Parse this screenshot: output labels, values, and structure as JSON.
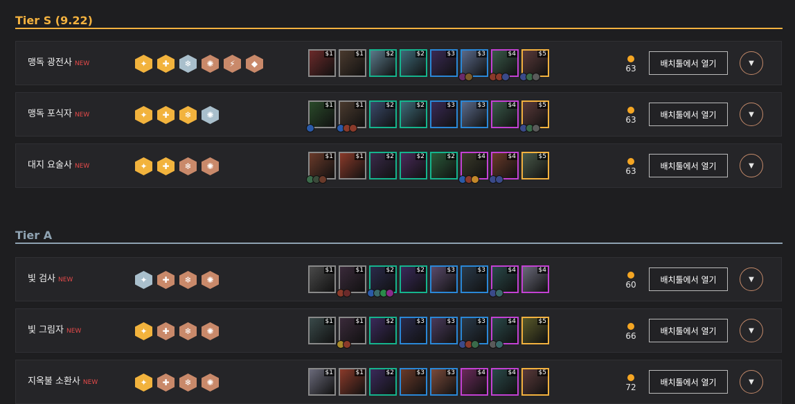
{
  "tiers": [
    {
      "title": "Tier S (9.22)"
    },
    {
      "title": "Tier A"
    }
  ],
  "open_label": "배치툴에서 열기",
  "new_label": "NEW",
  "icons": {
    "gold": "gold-coin-icon",
    "expand": "chevron-down-icon"
  },
  "colors": {
    "tierS": "#f4b23f",
    "tierA": "#8fa3b2",
    "cost1": "#8a8a8a",
    "cost2": "#15b58e",
    "cost3": "#2a88d8",
    "cost4": "#c441d4",
    "cost5": "#f4b23f"
  },
  "comps": [
    {
      "name": "맹독 광전사",
      "gold": "63",
      "traits": [
        "gold",
        "gold",
        "silver",
        "bronze",
        "bronze",
        "bronze"
      ],
      "champs": [
        {
          "cost": "$1",
          "color": "#6b2a2a",
          "items": []
        },
        {
          "cost": "$1",
          "color": "#4a3a2e",
          "items": []
        },
        {
          "cost": "$2",
          "color": "#5a7a8a",
          "items": []
        },
        {
          "cost": "$2",
          "color": "#3e6a78",
          "items": []
        },
        {
          "cost": "$3",
          "color": "#3a2a55",
          "items": []
        },
        {
          "cost": "$3",
          "color": "#5a6a8a",
          "items": [
            "#6a2a6a",
            "#7a5a2a"
          ]
        },
        {
          "cost": "$4",
          "color": "#3a5a4a",
          "items": [
            "#8a3a2a",
            "#8a3a2a",
            "#3a4a8a"
          ]
        },
        {
          "cost": "$5",
          "color": "#5a3a3a",
          "items": [
            "#3a4a8a",
            "#3a6a4a",
            "#5a5a5a"
          ]
        }
      ]
    },
    {
      "name": "맹독 포식자",
      "gold": "63",
      "traits": [
        "gold",
        "gold",
        "gold",
        "silver"
      ],
      "champs": [
        {
          "cost": "$1",
          "color": "#2a4a2a",
          "items": [
            "#2a5aa8"
          ]
        },
        {
          "cost": "$1",
          "color": "#4a3a2e",
          "items": [
            "#2a5aa8",
            "#8a3a2a",
            "#8a3a2a"
          ]
        },
        {
          "cost": "$2",
          "color": "#3a4a6a",
          "items": []
        },
        {
          "cost": "$2",
          "color": "#3e6a78",
          "items": []
        },
        {
          "cost": "$3",
          "color": "#3a2a55",
          "items": []
        },
        {
          "cost": "$3",
          "color": "#5a6a8a",
          "items": []
        },
        {
          "cost": "$4",
          "color": "#3a5a4a",
          "items": []
        },
        {
          "cost": "$5",
          "color": "#5a3a3a",
          "items": [
            "#3a4a8a",
            "#3a6a4a",
            "#5a5a5a"
          ]
        }
      ]
    },
    {
      "name": "대지 요술사",
      "gold": "63",
      "traits": [
        "gold",
        "gold",
        "bronze",
        "bronze"
      ],
      "champs": [
        {
          "cost": "$1",
          "color": "#6a3a2a",
          "items": [
            "#3a6a4a",
            "#3a4a3a",
            "#6a3a2a"
          ]
        },
        {
          "cost": "$1",
          "color": "#8a3a2a",
          "items": []
        },
        {
          "cost": "$2",
          "color": "#3a2a4a",
          "items": []
        },
        {
          "cost": "$2",
          "color": "#4a2a5a",
          "items": []
        },
        {
          "cost": "$2",
          "color": "#2a5a3a",
          "items": []
        },
        {
          "cost": "$4",
          "color": "#3a3a2a",
          "items": [
            "#2a5aa8",
            "#8a3a2a",
            "#c4882a"
          ]
        },
        {
          "cost": "$4",
          "color": "#6a3a2a",
          "items": [
            "#3a4a8a",
            "#3a4a8a"
          ]
        },
        {
          "cost": "$5",
          "color": "#4a5a4a",
          "items": []
        }
      ]
    },
    {
      "name": "빛 검사",
      "gold": "60",
      "traits": [
        "silver",
        "bronze",
        "bronze",
        "bronze"
      ],
      "champs": [
        {
          "cost": "$1",
          "color": "#4a4a4a",
          "items": []
        },
        {
          "cost": "$1",
          "color": "#3a2a3a",
          "items": [
            "#8a3a2a",
            "#6a2a2a"
          ]
        },
        {
          "cost": "$2",
          "color": "#2a2a4a",
          "items": [
            "#2a5aa8",
            "#3a6a6a",
            "#2a8a4a",
            "#8a2a8a"
          ]
        },
        {
          "cost": "$2",
          "color": "#3a2a5a",
          "items": []
        },
        {
          "cost": "$3",
          "color": "#5a4a6a",
          "items": []
        },
        {
          "cost": "$3",
          "color": "#2a3a4a",
          "items": []
        },
        {
          "cost": "$4",
          "color": "#2a4a4a",
          "items": [
            "#3a4a8a",
            "#3a6a6a"
          ]
        },
        {
          "cost": "$4",
          "color": "#6a6a7a",
          "items": []
        }
      ]
    },
    {
      "name": "빛 그림자",
      "gold": "66",
      "traits": [
        "gold",
        "bronze",
        "bronze",
        "bronze"
      ],
      "champs": [
        {
          "cost": "$1",
          "color": "#3a4a4a",
          "items": []
        },
        {
          "cost": "$1",
          "color": "#3a2a3a",
          "items": [
            "#a88a2a",
            "#8a3a2a"
          ]
        },
        {
          "cost": "$2",
          "color": "#3a2a5a",
          "items": []
        },
        {
          "cost": "$3",
          "color": "#2a2a4a",
          "items": []
        },
        {
          "cost": "$3",
          "color": "#4a3a5a",
          "items": []
        },
        {
          "cost": "$3",
          "color": "#2a3a4a",
          "items": [
            "#3a4a8a",
            "#8a3a2a",
            "#3a6a4a"
          ]
        },
        {
          "cost": "$4",
          "color": "#2a4a4a",
          "items": [
            "#5a5a5a",
            "#3a6a6a"
          ]
        },
        {
          "cost": "$5",
          "color": "#5a5a2a",
          "items": []
        }
      ]
    },
    {
      "name": "지옥불 소환사",
      "gold": "72",
      "traits": [
        "gold",
        "bronze",
        "bronze",
        "bronze"
      ],
      "champs": [
        {
          "cost": "$1",
          "color": "#6a6a7a",
          "items": []
        },
        {
          "cost": "$1",
          "color": "#8a3a2a",
          "items": []
        },
        {
          "cost": "$2",
          "color": "#3a2a5a",
          "items": []
        },
        {
          "cost": "$3",
          "color": "#6a3a2a",
          "items": []
        },
        {
          "cost": "$3",
          "color": "#7a4a3a",
          "items": []
        },
        {
          "cost": "$4",
          "color": "#6a2a5a",
          "items": []
        },
        {
          "cost": "$4",
          "color": "#2a4a4a",
          "items": []
        },
        {
          "cost": "$5",
          "color": "#5a3a3a",
          "items": []
        }
      ]
    }
  ]
}
